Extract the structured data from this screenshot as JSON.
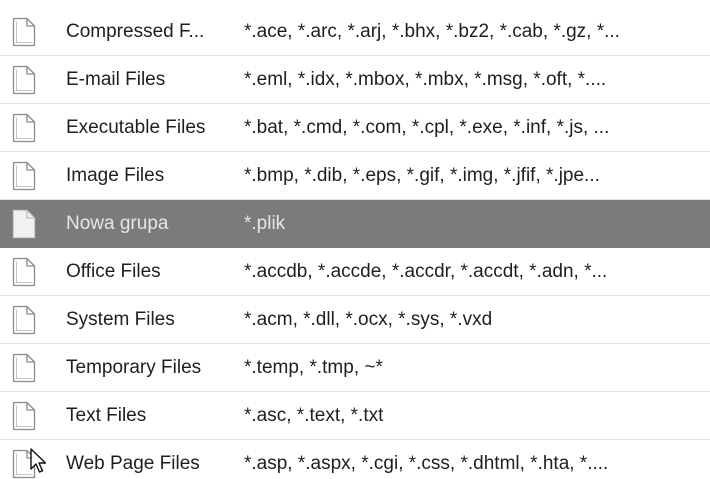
{
  "file_groups": {
    "rows": [
      {
        "name": "Compressed F...",
        "extensions": "*.ace, *.arc, *.arj, *.bhx, *.bz2, *.cab, *.gz, *...",
        "selected": false
      },
      {
        "name": "E-mail Files",
        "extensions": "*.eml, *.idx, *.mbox, *.mbx, *.msg, *.oft, *....",
        "selected": false
      },
      {
        "name": "Executable Files",
        "extensions": "*.bat, *.cmd, *.com, *.cpl, *.exe, *.inf, *.js, ...",
        "selected": false
      },
      {
        "name": "Image Files",
        "extensions": "*.bmp, *.dib, *.eps, *.gif, *.img, *.jfif, *.jpe...",
        "selected": false
      },
      {
        "name": "Nowa grupa",
        "extensions": "*.plik",
        "selected": true
      },
      {
        "name": "Office Files",
        "extensions": "*.accdb, *.accde, *.accdr, *.accdt, *.adn, *...",
        "selected": false
      },
      {
        "name": "System Files",
        "extensions": "*.acm, *.dll, *.ocx, *.sys, *.vxd",
        "selected": false
      },
      {
        "name": "Temporary Files",
        "extensions": "*.temp, *.tmp, ~*",
        "selected": false
      },
      {
        "name": "Text Files",
        "extensions": "*.asc, *.text, *.txt",
        "selected": false
      },
      {
        "name": "Web Page Files",
        "extensions": "*.asp, *.aspx, *.cgi, *.css, *.dhtml, *.hta, *....",
        "selected": false
      }
    ],
    "icon": "document-icon",
    "colors": {
      "selected_background": "#7b7b7b",
      "selected_text": "#e6e6e6",
      "text": "#1f1f1f",
      "separator": "#e3e3e3"
    }
  }
}
